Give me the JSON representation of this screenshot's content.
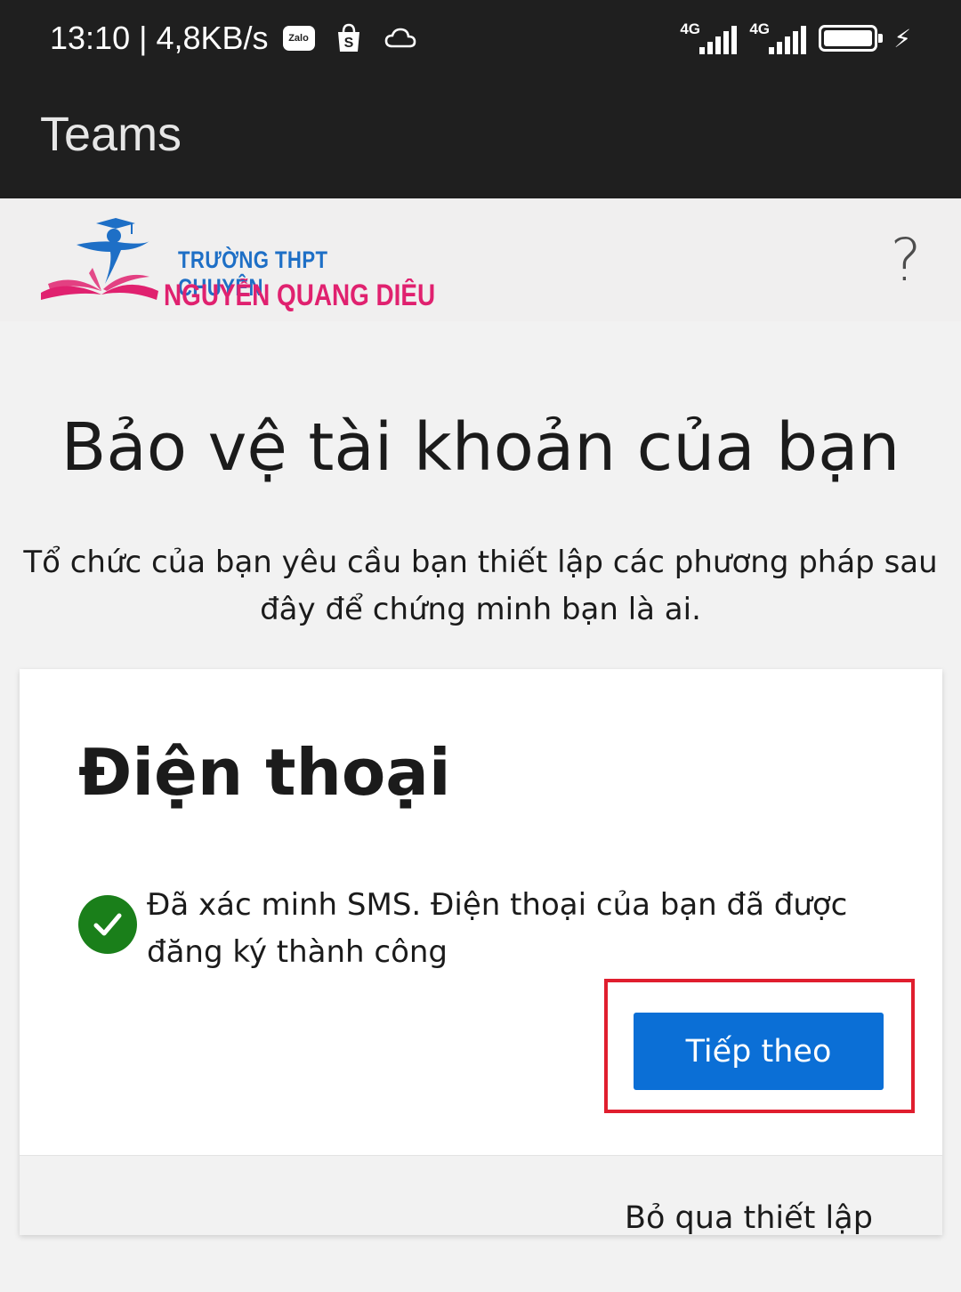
{
  "status_bar": {
    "time_speed": "13:10 | 4,8KB/s",
    "zalo_label": "Zalo",
    "shop_label": "S",
    "sim1_network": "4G",
    "sim2_network": "4G"
  },
  "app_bar": {
    "title": "Teams"
  },
  "banner": {
    "logo_line1": "TRƯỜNG THPT CHUYÊN",
    "logo_line2": "NGUYỄN QUANG DIÊU",
    "help": "?"
  },
  "main": {
    "title": "Bảo vệ tài khoản của bạn",
    "subtitle": "Tổ chức của bạn yêu cầu bạn thiết lập các phương pháp sau đây để chứng minh bạn là ai."
  },
  "card": {
    "title": "Điện thoại",
    "status_message": "Đã xác minh SMS. Điện thoại của bạn đã được đăng ký thành công",
    "next_button": "Tiếp theo",
    "skip_link": "Bỏ qua thiết lập"
  },
  "colors": {
    "top_bar": "#1f1f1f",
    "primary_button": "#0b6fd6",
    "success": "#1a7f1a",
    "highlight": "#e01e2e",
    "logo_blue": "#1e6fc6",
    "logo_pink": "#e0216f"
  },
  "icons": [
    "zalo-icon",
    "shop-icon",
    "cloud-icon",
    "signal-icon",
    "battery-icon",
    "charging-icon",
    "school-logo-icon",
    "help-icon",
    "check-circle-icon"
  ]
}
